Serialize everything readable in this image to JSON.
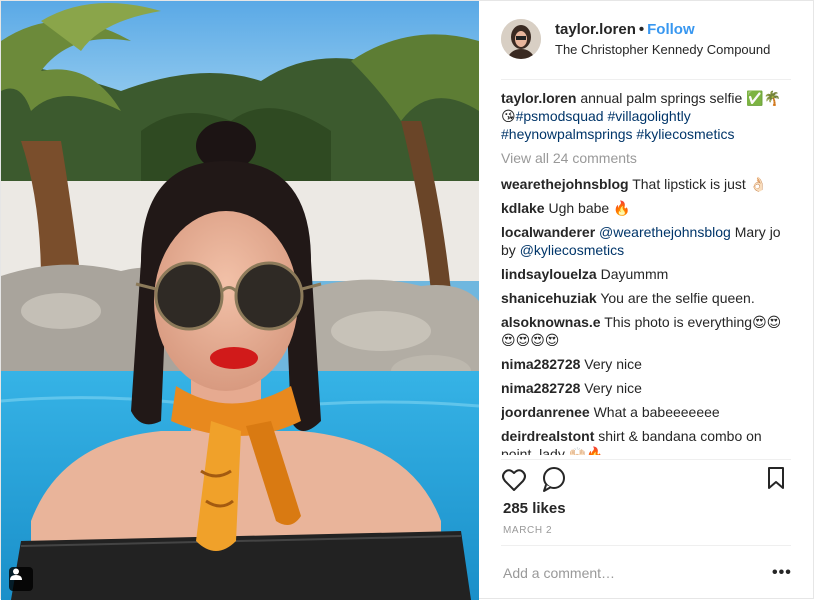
{
  "post": {
    "username": "taylor.loren",
    "separator": "•",
    "follow_label": "Follow",
    "location": "The Christopher Kennedy Compound",
    "caption": {
      "username": "taylor.loren",
      "text": "annual palm springs selfie ✅🌴😘",
      "hashtags": [
        "#psmodsquad",
        "#villagolightly",
        "#heynowpalmsprings",
        "#kyliecosmetics"
      ]
    },
    "view_all_comments": "View all 24 comments",
    "comments": [
      {
        "user": "wearethejohnsblog",
        "text": "That lipstick is just 👌🏻"
      },
      {
        "user": "kdlake",
        "text": "Ugh babe 🔥"
      },
      {
        "user": "localwanderer",
        "mention1": "@wearethejohnsblog",
        "text": "Mary jo by",
        "mention2": "@kyliecosmetics"
      },
      {
        "user": "lindsaylouelza",
        "text": "Dayummm"
      },
      {
        "user": "shanicehuziak",
        "text": "You are the selfie queen."
      },
      {
        "user": "alsoknownas.e",
        "text": "This photo is everything😍😍😍😍😍😍"
      },
      {
        "user": "nima282728",
        "text": "Very nice"
      },
      {
        "user": "nima282728",
        "text": "Very nice"
      },
      {
        "user": "joordanrenee",
        "text": "What a babeeeeeee"
      },
      {
        "user": "deirdrealstont",
        "text": "shirt & bandana combo on point, lady 🙌🏻🔥"
      }
    ],
    "likes": "285 likes",
    "date": "MARCH 2",
    "add_comment_placeholder": "Add a comment…",
    "more_label": "•••",
    "icons": [
      "heart-icon",
      "comment-icon",
      "bookmark-icon",
      "tag-user-icon",
      "more-icon"
    ]
  }
}
